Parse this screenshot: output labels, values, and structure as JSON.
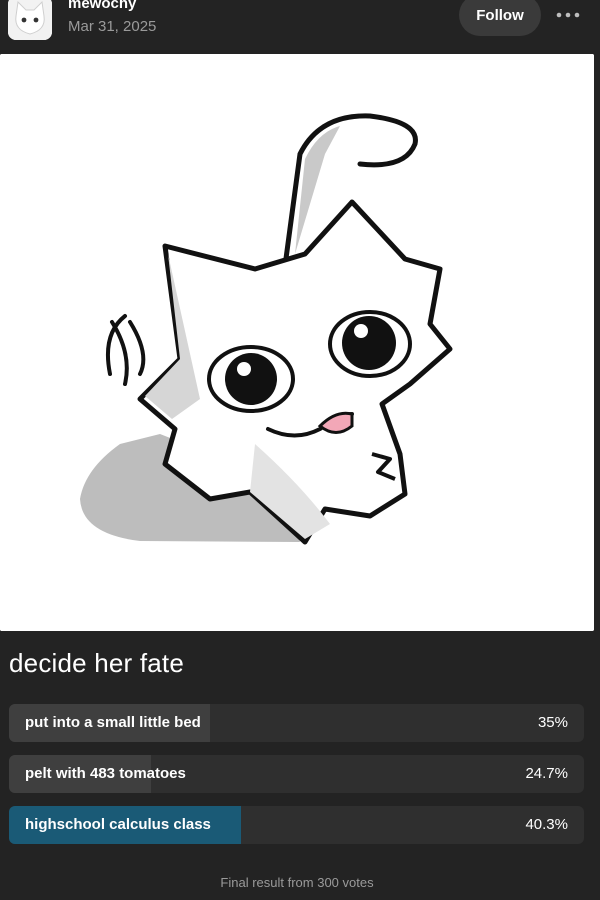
{
  "header": {
    "username": "mewochy",
    "date": "Mar 31, 2025",
    "follow_label": "Follow",
    "more_icon": "ellipsis-icon",
    "avatar_icon": "cat-avatar-icon"
  },
  "post": {
    "image_alt": "white cat drawing",
    "poll": {
      "question": "decide her fate",
      "options": [
        {
          "label": "put into a small little bed",
          "percent_text": "35%",
          "percent": 35.0,
          "winner": false
        },
        {
          "label": "pelt with 483 tomatoes",
          "percent_text": "24.7%",
          "percent": 24.7,
          "winner": false
        },
        {
          "label": "highschool calculus class",
          "percent_text": "40.3%",
          "percent": 40.3,
          "winner": true
        }
      ],
      "footer": "Final result from 300 votes"
    }
  },
  "colors": {
    "background": "#232323",
    "winner_fill": "#1a5a76",
    "option_fill": "#3f3f3f",
    "option_track": "#2f2f2f"
  }
}
